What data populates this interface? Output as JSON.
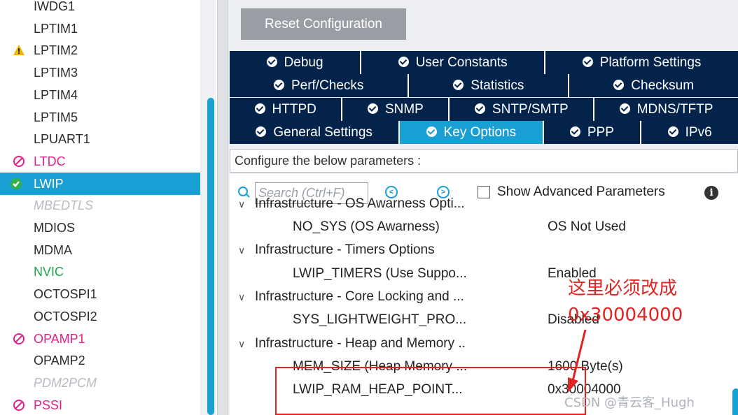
{
  "left_list": [
    {
      "label": "IWDG1",
      "style": "normal",
      "icon": ""
    },
    {
      "label": "LPTIM1",
      "style": "normal",
      "icon": ""
    },
    {
      "label": "LPTIM2",
      "style": "normal",
      "icon": "warning-icon"
    },
    {
      "label": "LPTIM3",
      "style": "normal",
      "icon": ""
    },
    {
      "label": "LPTIM4",
      "style": "normal",
      "icon": ""
    },
    {
      "label": "LPTIM5",
      "style": "normal",
      "icon": ""
    },
    {
      "label": "LPUART1",
      "style": "normal",
      "icon": ""
    },
    {
      "label": "LTDC",
      "style": "pink",
      "icon": "blocked-icon"
    },
    {
      "label": "LWIP",
      "style": "selected",
      "icon": "check-circle-icon"
    },
    {
      "label": "MBEDTLS",
      "style": "grey",
      "icon": ""
    },
    {
      "label": "MDIOS",
      "style": "normal",
      "icon": ""
    },
    {
      "label": "MDMA",
      "style": "normal",
      "icon": ""
    },
    {
      "label": "NVIC",
      "style": "green",
      "icon": ""
    },
    {
      "label": "OCTOSPI1",
      "style": "normal",
      "icon": ""
    },
    {
      "label": "OCTOSPI2",
      "style": "normal",
      "icon": ""
    },
    {
      "label": "OPAMP1",
      "style": "pink",
      "icon": "blocked-icon"
    },
    {
      "label": "OPAMP2",
      "style": "normal",
      "icon": ""
    },
    {
      "label": "PDM2PCM",
      "style": "grey",
      "icon": ""
    },
    {
      "label": "PSSI",
      "style": "pink",
      "icon": "blocked-icon"
    }
  ],
  "reset_label": "Reset Configuration",
  "tab_rows": [
    [
      "Debug",
      "User Constants",
      "Platform Settings"
    ],
    [
      "Perf/Checks",
      "Statistics",
      "Checksum"
    ],
    [
      "HTTPD",
      "SNMP",
      "SNTP/SMTP",
      "MDNS/TFTP"
    ],
    [
      "General Settings",
      "Key Options",
      "PPP",
      "IPv6"
    ]
  ],
  "active_tab": "Key Options",
  "configure_text": "Configure the below parameters :",
  "search_placeholder": "Search (Ctrl+F)",
  "show_advanced_label": "Show Advanced Parameters",
  "params": [
    {
      "type": "group",
      "label": "Infrastructure - OS Awarness Opti..."
    },
    {
      "type": "param",
      "name": "NO_SYS (OS Awarness)",
      "value": "OS Not Used"
    },
    {
      "type": "group",
      "label": "Infrastructure - Timers Options"
    },
    {
      "type": "param",
      "name": "LWIP_TIMERS (Use Suppo...",
      "value": "Enabled"
    },
    {
      "type": "group",
      "label": "Infrastructure - Core Locking and ..."
    },
    {
      "type": "param",
      "name": "SYS_LIGHTWEIGHT_PRO...",
      "value": "Disabled"
    },
    {
      "type": "group",
      "label": "Infrastructure - Heap and Memory .."
    },
    {
      "type": "param",
      "name": "MEM_SIZE (Heap Memory ...",
      "value": "1600 Byte(s)"
    },
    {
      "type": "param",
      "name": "LWIP_RAM_HEAP_POINT...",
      "value": "0x30004000"
    }
  ],
  "annotation": {
    "line1": "这里必须改成",
    "line2": "0x30004000"
  },
  "watermark": "CSDN @青云客_Hugh",
  "colors": {
    "selected": "#1a9fd5",
    "tab_bg": "#03234b",
    "annotation": "#e02424",
    "error": "#e0228a"
  }
}
